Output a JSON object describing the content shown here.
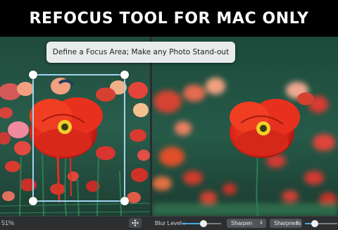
{
  "banner": {
    "title": "REFOCUS TOOL FOR MAC ONLY"
  },
  "tooltip": {
    "text": "Define a Focus Area; Make any Photo Stand-out"
  },
  "left_pane": {
    "zoom_text": "51%"
  },
  "toolbar": {
    "blur_label": "Blur Level :",
    "blur_level": 0.55,
    "mode_select": "Sharpen",
    "sharpness_select": "Sharpness",
    "sharpness_level": 0.3
  },
  "icons": {
    "move": "move-arrows-icon",
    "dropdown_arrows": "updown-chevron-icon"
  },
  "colors": {
    "focus_outline": "#9fd4f0",
    "slider_accent": "#4aa8e0",
    "toolbar_bg": "#2c2e30"
  }
}
